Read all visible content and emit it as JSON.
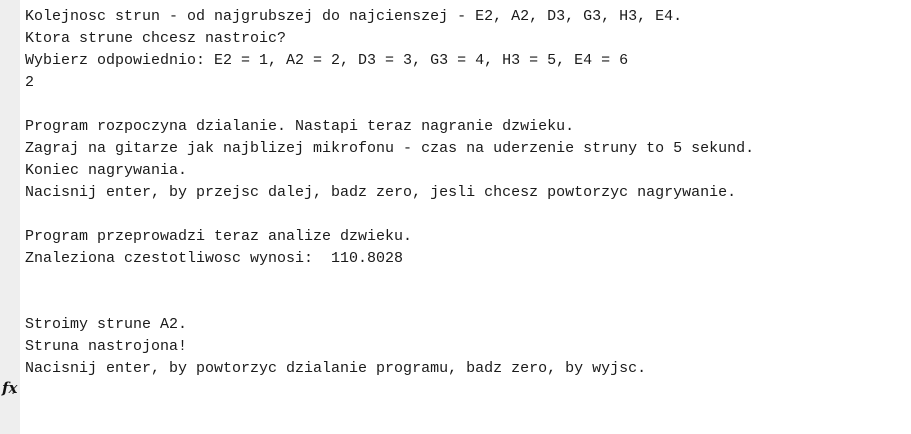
{
  "console": {
    "lines": [
      "Kolejnosc strun - od najgrubszej do najcienszej - E2, A2, D3, G3, H3, E4.",
      "Ktora strune chcesz nastroic?",
      "Wybierz odpowiednio: E2 = 1, A2 = 2, D3 = 3, G3 = 4, H3 = 5, E4 = 6",
      "2",
      "",
      "Program rozpoczyna dzialanie. Nastapi teraz nagranie dzwieku.",
      "Zagraj na gitarze jak najblizej mikrofonu - czas na uderzenie struny to 5 sekund.",
      "Koniec nagrywania.",
      "Nacisnij enter, by przejsc dalej, badz zero, jesli chcesz powtorzyc nagrywanie.",
      "",
      "Program przeprowadzi teraz analize dzwieku.",
      "Znaleziona czestotliwosc wynosi:  110.8028",
      "",
      "",
      "Stroimy strune A2.",
      "Struna nastrojona!",
      "Nacisnij enter, by powtorzyc dzialanie programu, badz zero, by wyjsc."
    ]
  },
  "gutter": {
    "prompt_icon": "fx-icon",
    "prompt_text": "fx"
  }
}
